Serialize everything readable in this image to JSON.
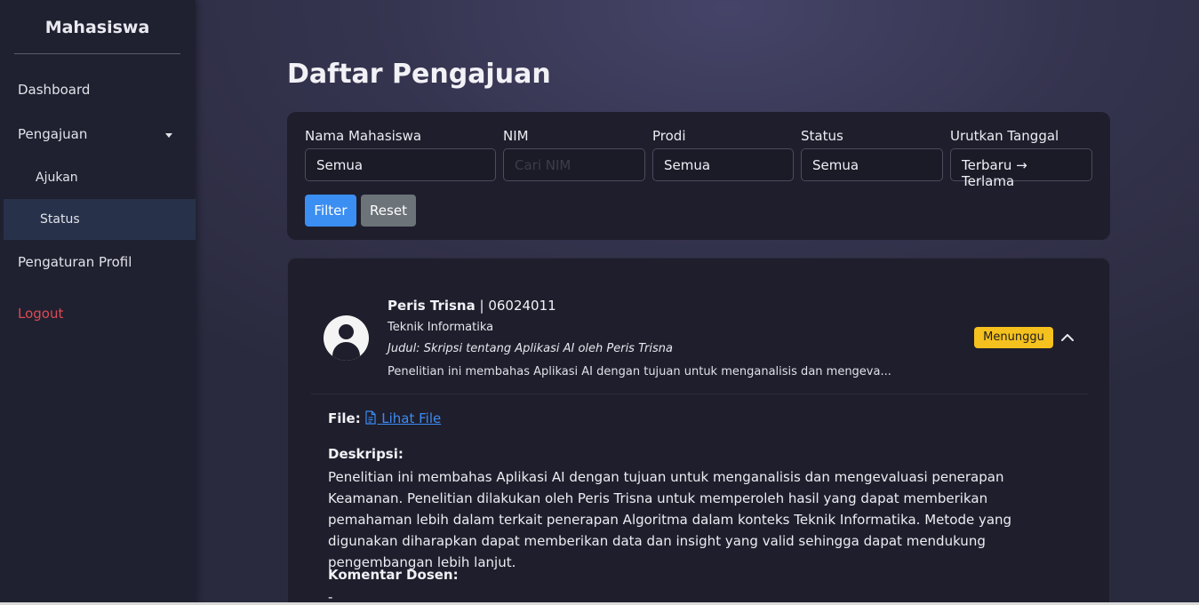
{
  "sidebar": {
    "brand": "Mahasiswa",
    "items": {
      "dashboard": "Dashboard",
      "pengajuan": "Pengajuan",
      "ajukan": "Ajukan",
      "status": "Status",
      "profil": "Pengaturan Profil",
      "logout": "Logout"
    }
  },
  "main": {
    "title": "Daftar Pengajuan",
    "filters": {
      "nama": {
        "label": "Nama Mahasiswa",
        "value": "Semua"
      },
      "nim": {
        "label": "NIM",
        "placeholder": "Cari NIM"
      },
      "prodi": {
        "label": "Prodi",
        "value": "Semua"
      },
      "status": {
        "label": "Status",
        "value": "Semua"
      },
      "urut": {
        "label": "Urutkan Tanggal",
        "value": "Terbaru → Terlama"
      },
      "filter_button": "Filter",
      "reset_button": "Reset"
    },
    "submission": {
      "name": "Peris Trisna",
      "separator": " | ",
      "nim": "06024011",
      "prodi": "Teknik Informatika",
      "judul": "Judul: Skripsi tentang Aplikasi AI oleh Peris Trisna",
      "excerpt": "Penelitian ini membahas Aplikasi AI dengan tujuan untuk menganalisis dan mengeva...",
      "status": "Menunggu",
      "status_color": "#f5c11e",
      "file_label": "File:",
      "file_link": "Lihat File",
      "deskripsi_label": "Deskripsi:",
      "deskripsi": "Penelitian ini membahas Aplikasi AI dengan tujuan untuk menganalisis dan mengevaluasi penerapan Keamanan. Penelitian dilakukan oleh Peris Trisna untuk memperoleh hasil yang dapat memberikan pemahaman lebih dalam terkait penerapan Algoritma dalam konteks Teknik Informatika. Metode yang digunakan diharapkan dapat memberikan data dan insight yang valid sehingga dapat mendukung pengembangan lebih lanjut.",
      "komentar_label": "Komentar Dosen:",
      "komentar": "-"
    }
  }
}
